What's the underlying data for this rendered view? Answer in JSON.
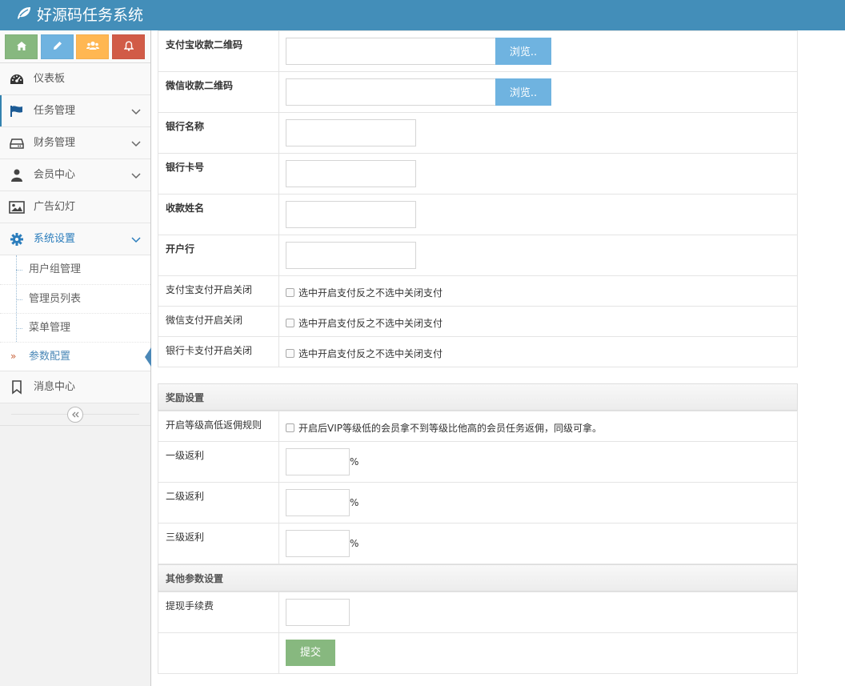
{
  "app": {
    "title": "好源码任务系统"
  },
  "shortcuts": [
    {
      "icon": "home-icon",
      "color": "#87b87f"
    },
    {
      "icon": "pencil-icon",
      "color": "#6fb3e0"
    },
    {
      "icon": "users-icon",
      "color": "#ffb752"
    },
    {
      "icon": "bell-icon",
      "color": "#d15b47"
    }
  ],
  "sidebar": {
    "items": [
      {
        "label": "仪表板",
        "icon": "dashboard-icon"
      },
      {
        "label": "任务管理",
        "icon": "flag-icon",
        "expandable": true
      },
      {
        "label": "财务管理",
        "icon": "hdd-icon",
        "expandable": true
      },
      {
        "label": "会员中心",
        "icon": "user-icon",
        "expandable": true
      },
      {
        "label": "广告幻灯",
        "icon": "picture-icon"
      },
      {
        "label": "系统设置",
        "icon": "gear-icon",
        "expandable": true,
        "open": true
      },
      {
        "label": "消息中心",
        "icon": "bookmark-icon"
      }
    ],
    "submenu": [
      {
        "label": "用户组管理"
      },
      {
        "label": "管理员列表"
      },
      {
        "label": "菜单管理"
      },
      {
        "label": "参数配置",
        "current": true
      }
    ]
  },
  "form": {
    "payment_rows": [
      {
        "label": "支付宝收款二维码",
        "type": "file",
        "button": "浏览.."
      },
      {
        "label": "微信收款二维码",
        "type": "file",
        "button": "浏览.."
      },
      {
        "label": "银行名称",
        "type": "text",
        "value": ""
      },
      {
        "label": "银行卡号",
        "type": "text",
        "value": ""
      },
      {
        "label": "收款姓名",
        "type": "text",
        "value": ""
      },
      {
        "label": "开户行",
        "type": "text",
        "value": ""
      }
    ],
    "toggle_rows": [
      {
        "label": "支付宝支付开启关闭",
        "checkbox_text": "选中开启支付反之不选中关闭支付",
        "checked": false
      },
      {
        "label": "微信支付开启关闭",
        "checkbox_text": "选中开启支付反之不选中关闭支付",
        "checked": false
      },
      {
        "label": "银行卡支付开启关闭",
        "checkbox_text": "选中开启支付反之不选中关闭支付",
        "checked": false
      }
    ],
    "reward_section": {
      "title": "奖励设置",
      "rule_row": {
        "label": "开启等级高低返佣规则",
        "checkbox_text": "开启后VIP等级低的会员拿不到等级比他高的会员任务返佣，同级可拿。",
        "checked": false
      },
      "rebates": [
        {
          "label": "一级返利",
          "value": "",
          "unit": "%"
        },
        {
          "label": "二级返利",
          "value": "",
          "unit": "%"
        },
        {
          "label": "三级返利",
          "value": "",
          "unit": "%"
        }
      ]
    },
    "other_section": {
      "title": "其他参数设置",
      "fee_label": "提现手续费",
      "fee_value": ""
    },
    "submit_label": "提交"
  }
}
